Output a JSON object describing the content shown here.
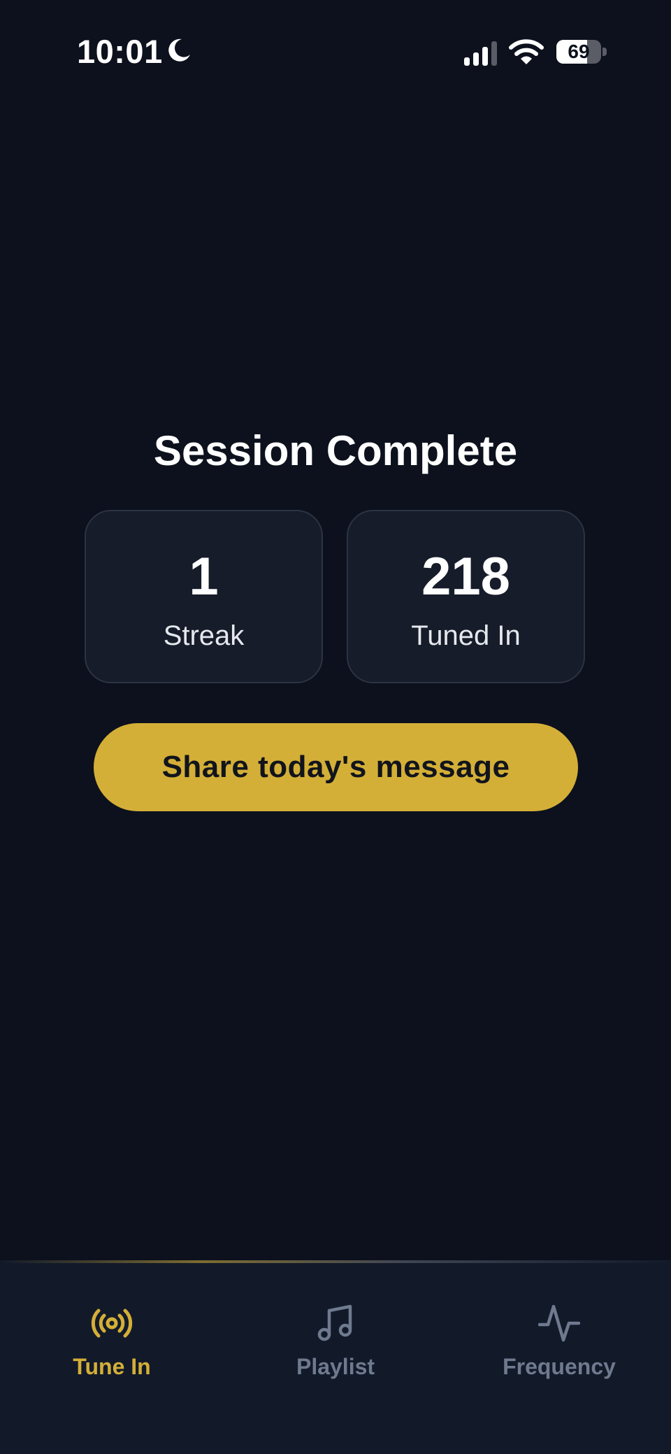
{
  "status_bar": {
    "time": "10:01",
    "battery_level": "69",
    "battery_fraction": 0.69,
    "icons": [
      "moon-icon",
      "signal-icon",
      "wifi-icon",
      "battery-icon"
    ]
  },
  "session": {
    "title": "Session Complete",
    "stats": [
      {
        "value": "1",
        "label": "Streak"
      },
      {
        "value": "218",
        "label": "Tuned In"
      }
    ],
    "share_label": "Share today's message"
  },
  "tab_bar": {
    "items": [
      {
        "label": "Tune In",
        "icon": "broadcast-icon",
        "active": true
      },
      {
        "label": "Playlist",
        "icon": "music-note-icon",
        "active": false
      },
      {
        "label": "Frequency",
        "icon": "pulse-icon",
        "active": false
      }
    ]
  },
  "colors": {
    "background": "#0c111d",
    "card": "#161c29",
    "accent": "#d4af37",
    "tab_inactive": "#6f7a8f"
  }
}
